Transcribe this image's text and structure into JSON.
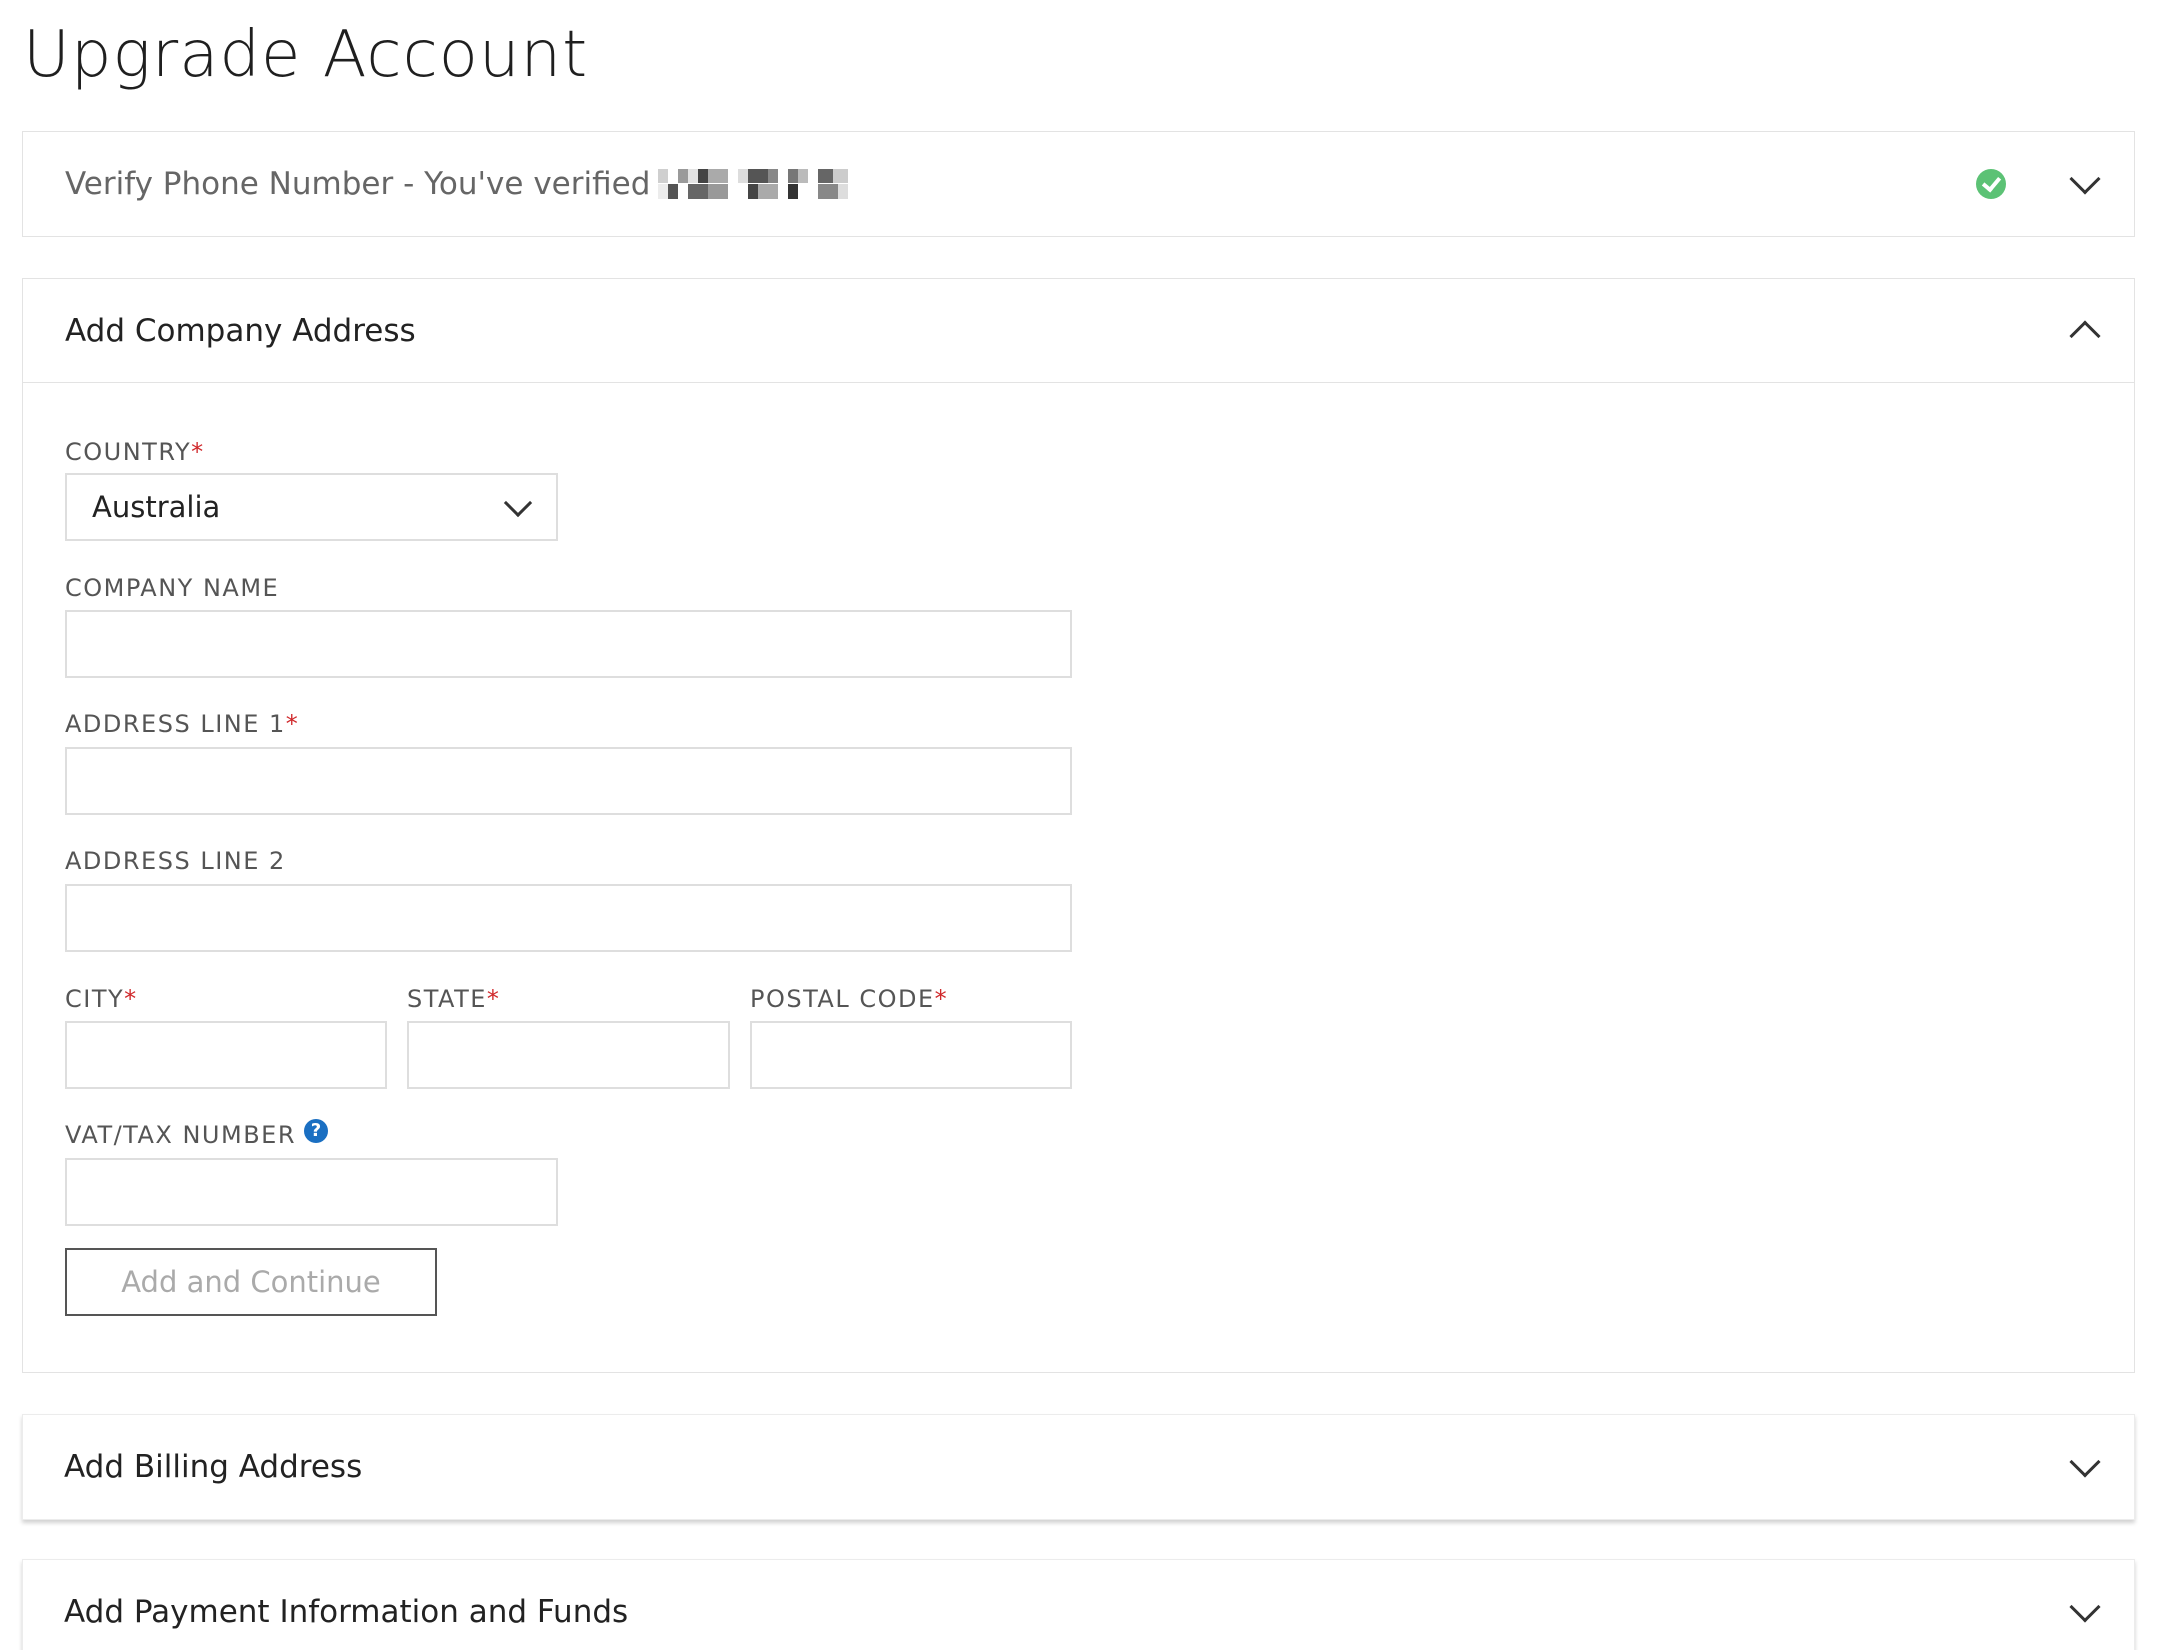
{
  "page": {
    "title": "Upgrade Account"
  },
  "verify_panel": {
    "title": "Verify Phone Number - You've verified",
    "status_icon": "check-circle-icon",
    "status_color": "#5cc275"
  },
  "company_panel": {
    "title": "Add Company Address",
    "fields": {
      "country": {
        "label": "COUNTRY",
        "required": "*",
        "value": "Australia"
      },
      "company_name": {
        "label": "COMPANY NAME",
        "value": ""
      },
      "address_line_1": {
        "label": "ADDRESS LINE 1",
        "required": "*",
        "value": ""
      },
      "address_line_2": {
        "label": "ADDRESS LINE 2",
        "value": ""
      },
      "city": {
        "label": "CITY",
        "required": "*",
        "value": ""
      },
      "state": {
        "label": "STATE",
        "required": "*",
        "value": ""
      },
      "postal_code": {
        "label": "POSTAL CODE",
        "required": "*",
        "value": ""
      },
      "vat_tax_number": {
        "label": "VAT/TAX NUMBER",
        "help_icon": "question-circle-icon",
        "value": ""
      }
    },
    "submit_label": "Add and Continue"
  },
  "billing_panel": {
    "title": "Add Billing Address"
  },
  "payment_panel": {
    "title": "Add Payment Information and Funds"
  },
  "colors": {
    "required": "#d0282b",
    "help": "#1a6fc2",
    "success": "#5cc275"
  }
}
